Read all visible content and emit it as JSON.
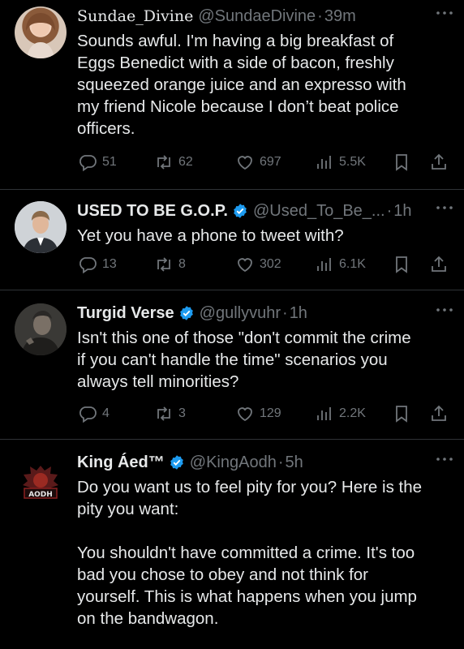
{
  "tweets": [
    {
      "name": "Sundae_Divine",
      "handle": "@SundaeDivine",
      "time": "39m",
      "verified": false,
      "text": "Sounds awful. I'm having a big breakfast of\nEggs Benedict with a side of bacon, freshly\nsqueezed orange juice and an expresso with\nmy friend Nicole because I don’t beat police\nofficers.",
      "replies": "51",
      "reposts": "62",
      "likes": "697",
      "views": "5.5K"
    },
    {
      "name": "USED TO BE G.O.P.",
      "handle": "@Used_To_Be_...",
      "time": "1h",
      "verified": true,
      "text": "Yet you have a phone to tweet with?",
      "replies": "13",
      "reposts": "8",
      "likes": "302",
      "views": "6.1K"
    },
    {
      "name": "Turgid Verse",
      "handle": "@gullyvuhr",
      "time": "1h",
      "verified": true,
      "text": "Isn't this one of those \"don't commit the crime\nif you can't handle the time\" scenarios you\nalways tell minorities?",
      "replies": "4",
      "reposts": "3",
      "likes": "129",
      "views": "2.2K"
    },
    {
      "name": "King Áed™",
      "handle": "@KingAodh",
      "time": "5h",
      "verified": true,
      "avatar_text": "AODH",
      "text": "Do you want us to feel pity for you? Here is the\npity you want:\n\nYou shouldn't have committed a crime. It's too\nbad you chose to obey and not think for\nyourself. This is what happens when you jump\non the bandwagon."
    }
  ],
  "colors": {
    "background": "#000000",
    "text": "#e7e9ea",
    "muted": "#71767b",
    "verified": "#1d9bf0",
    "divider": "#2f3336"
  },
  "icons": [
    "reply-icon",
    "repost-icon",
    "like-icon",
    "views-icon",
    "bookmark-icon",
    "share-icon",
    "more-icon",
    "verified-badge-icon"
  ]
}
